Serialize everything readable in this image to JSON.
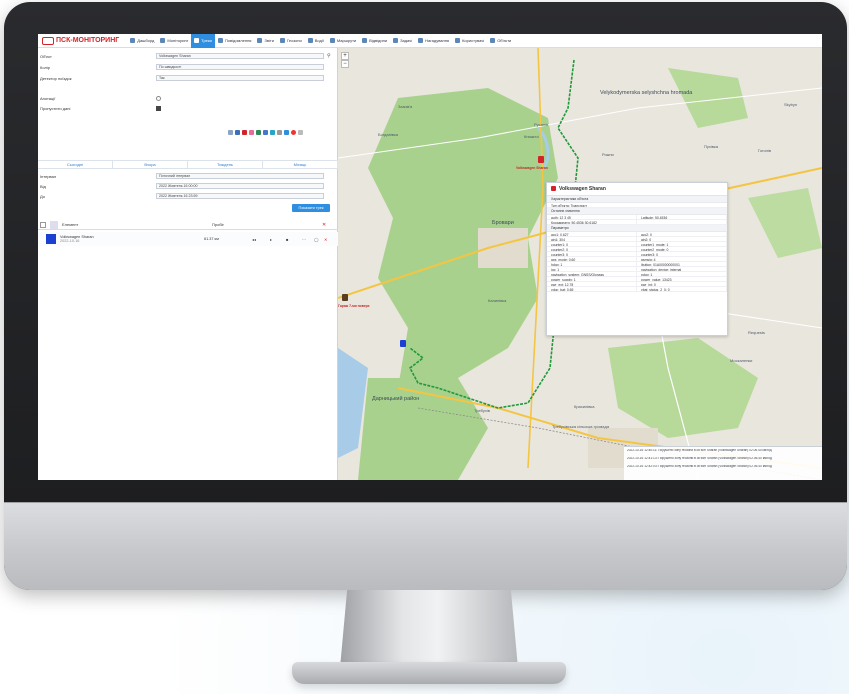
{
  "app": {
    "logo_text": "ПСК-МОНІТОРИНГ",
    "nav": [
      {
        "label": "Дашборд",
        "active": false
      },
      {
        "label": "Моніторинг",
        "active": false
      },
      {
        "label": "Треки",
        "active": true
      },
      {
        "label": "Повідомлення",
        "active": false
      },
      {
        "label": "Звіти",
        "active": false
      },
      {
        "label": "Геозони",
        "active": false
      },
      {
        "label": "Водії",
        "active": false
      },
      {
        "label": "Маршрути",
        "active": false
      },
      {
        "label": "Відвідини",
        "active": false
      },
      {
        "label": "Задачі",
        "active": false
      },
      {
        "label": "Нагадування",
        "active": false
      },
      {
        "label": "Користувачі",
        "active": false
      },
      {
        "label": "Об'єкти",
        "active": false
      }
    ]
  },
  "form": {
    "object_label": "Об'єкт",
    "object_value": "Volkswagen Sharan",
    "color_label": "Колір",
    "color_value": "По швидкості",
    "trip_detector_label": "Детектор поїздок",
    "trip_detector_value": "Так",
    "annotations_label": "Анотації",
    "skip_data_label": "Пропустити дані",
    "interval_label": "Інтервал",
    "interval_value": "Поточний інтервал",
    "from_label": "Від",
    "from_value": "2022 Жовтень 16 00:00",
    "to_label": "До",
    "to_value": "2022 Жовтень 16 23:59",
    "show_button": "Показати трек"
  },
  "tabs": [
    "Сьогодні",
    "Вчора",
    "Тиждень",
    "Місяць"
  ],
  "table": {
    "col_object": "Елемент",
    "col_mileage": "Пробіг",
    "rows": [
      {
        "name": "Volkswagen Sharan",
        "date": "2022-10-16",
        "mileage": "61.37 км"
      }
    ]
  },
  "map": {
    "labels": [
      "Velykodymerska selyshchna hromada",
      "Бровари",
      "Дарницький район",
      "Калинівка",
      "Княжичі",
      "Требухів",
      "Богданівка",
      "Красилівка",
      "Русанів",
      "Рожни",
      "Skybyn",
      "Зазим'я",
      "Гоголів",
      "Пухівка",
      "Requests",
      "Москаленки",
      "Требухівська сільська громада"
    ],
    "marker_label": "Volkswagen Sharan",
    "marker2_label": "Гараж 7-ми поверх"
  },
  "popup": {
    "title": "Volkswagen Sharan",
    "section_object": "Характеристики об'єкта",
    "object_type": "Тип об'єкта: Транспорт",
    "section_dates": "Останнє значення",
    "auth_left": "auth: 12 3 45",
    "auth_right": "Latitude: 50.4536",
    "driver_left": "Координати: 50.4536 30.6182",
    "section_params": "Параметри",
    "params": [
      [
        "acc1: 0.627",
        "acc2: 0"
      ],
      [
        "ain1: 304",
        "ain2: 0"
      ],
      [
        "counter1: 0",
        "counter1_mode: 1"
      ],
      [
        "counter2: 0",
        "counter2_mode: 0"
      ],
      [
        "counter3: 0",
        "counter3: 0"
      ],
      [
        "gps_mode: 0.60",
        "gsmsig: 4"
      ],
      [
        "hdop: 1",
        "ibutton: 01A00000000001"
      ],
      [
        "ioc: 1",
        "navigation_device: internal"
      ],
      [
        "navigation_system: GNSS/Glonass",
        "pdop: 1"
      ],
      [
        "power_supply: 1",
        "power_value: 13423"
      ],
      [
        "pwr_ext: 12.78",
        "pwr_int: 0"
      ],
      [
        "vdop_bat: 0.65",
        "vbat_status_2_0: 0"
      ]
    ]
  },
  "events": [
    "2022-10-16 12:40:11: Порушено зону геозони в об'єкті Sharan (Volkswagen Sharan) 02.06.40 км/год",
    "2022-10-16 12:41:13: Порушено зону геозони в об'єкті Sharan (Volkswagen Sharan) 02.06.40 км/год",
    "2022-10-16 12:42:03: Порушено зону геозони в об'єкті Sharan (Volkswagen Sharan) 02.06.40 км/год"
  ],
  "colors": {
    "accent": "#2f8ee0",
    "brand": "#d2232a",
    "track": "#1f9a3a",
    "forest": "#a9d18e",
    "water": "#a8cbe8"
  }
}
